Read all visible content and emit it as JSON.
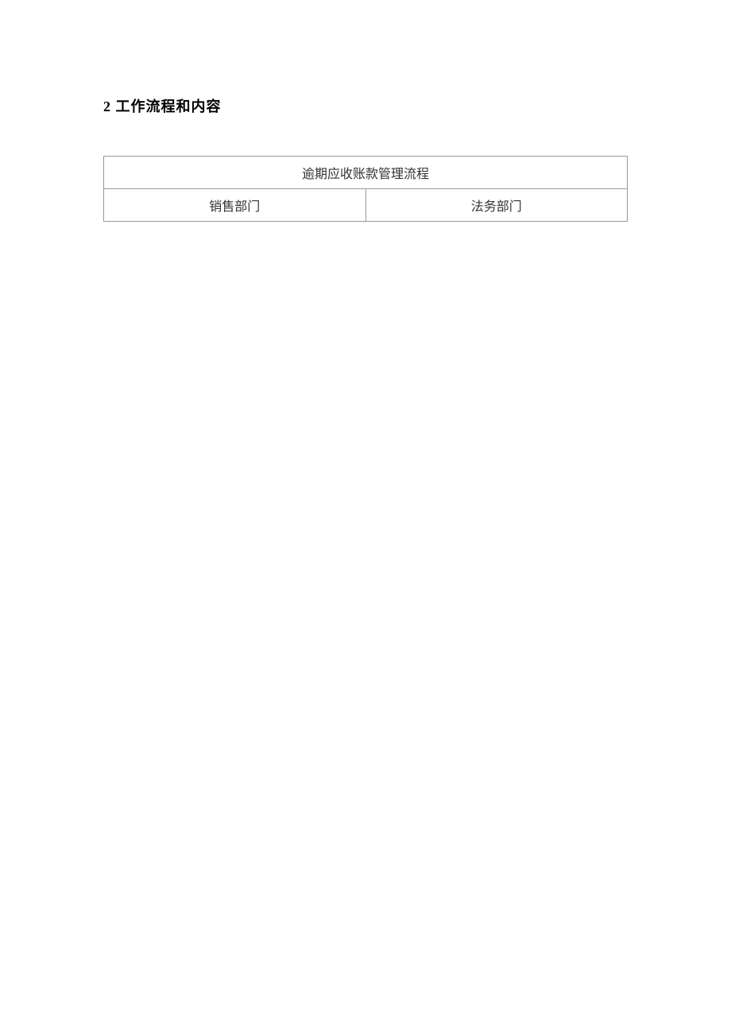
{
  "heading": "2 工作流程和内容",
  "table": {
    "title": "逾期应收账款管理流程",
    "departments": [
      "销售部门",
      "法务部门"
    ]
  }
}
